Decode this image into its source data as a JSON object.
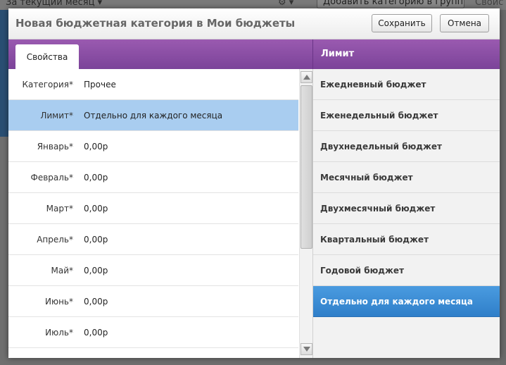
{
  "background": {
    "period_dropdown": "За текущий месяц ▾",
    "gear_menu": "⚙ ▾",
    "add_to_group_button": "Добавить категорию в группу ▾",
    "properties_tab": "Свойс"
  },
  "dialog": {
    "title": "Новая бюджетная категория в Мои бюджеты",
    "save_label": "Сохранить",
    "cancel_label": "Отмена",
    "tab_properties": "Свойства",
    "limit_header": "Лимит"
  },
  "properties": [
    {
      "label": "Категория*",
      "value": "Прочее"
    },
    {
      "label": "Лимит*",
      "value": "Отдельно для каждого месяца"
    },
    {
      "label": "Январь*",
      "value": "0,00р"
    },
    {
      "label": "Февраль*",
      "value": "0,00р"
    },
    {
      "label": "Март*",
      "value": "0,00р"
    },
    {
      "label": "Апрель*",
      "value": "0,00р"
    },
    {
      "label": "Май*",
      "value": "0,00р"
    },
    {
      "label": "Июнь*",
      "value": "0,00р"
    },
    {
      "label": "Июль*",
      "value": "0,00р"
    }
  ],
  "limit_options": [
    "Ежедневный бюджет",
    "Еженедельный бюджет",
    "Двухнедельный бюджет",
    "Месячный бюджет",
    "Двухмесячный бюджет",
    "Квартальный бюджет",
    "Годовой бюджет",
    "Отдельно для каждого месяца"
  ],
  "colors": {
    "purple_header": "#8a4ea5",
    "selected_row": "#a9cdf0",
    "active_option": "#3a8bd4"
  },
  "icons": {
    "scroll_up": "triangle-up-icon",
    "scroll_down": "triangle-down-icon"
  }
}
